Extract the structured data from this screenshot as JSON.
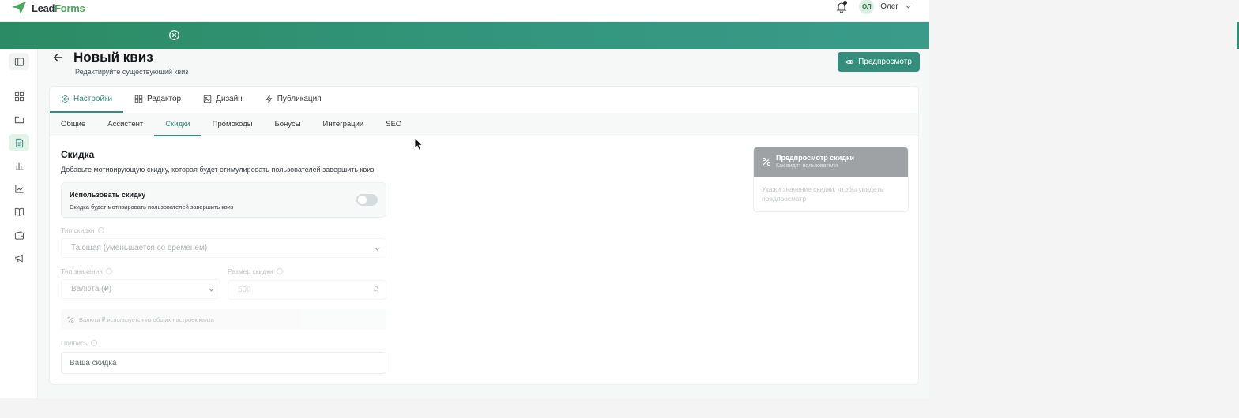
{
  "header": {
    "logo_lead": "Lead",
    "logo_forms": "Forms",
    "user_initials": "ОЛ",
    "user_name": "Олег"
  },
  "page": {
    "title": "Новый квиз",
    "subtitle": "Редактируйте существующий квиз",
    "preview_button": "Предпросмотр"
  },
  "tabs": [
    {
      "label": "Настройки",
      "icon": "gear-icon",
      "active": true
    },
    {
      "label": "Редактор",
      "icon": "grid-icon",
      "active": false
    },
    {
      "label": "Дизайн",
      "icon": "image-icon",
      "active": false
    },
    {
      "label": "Публикация",
      "icon": "bolt-icon",
      "active": false
    }
  ],
  "subtabs": [
    {
      "label": "Общие",
      "active": false
    },
    {
      "label": "Ассистент",
      "active": false
    },
    {
      "label": "Скидки",
      "active": true
    },
    {
      "label": "Промокоды",
      "active": false
    },
    {
      "label": "Бонусы",
      "active": false
    },
    {
      "label": "Интеграции",
      "active": false
    },
    {
      "label": "SEO",
      "active": false
    }
  ],
  "discount": {
    "title": "Скидка",
    "description": "Добавьте мотивирующую скидку, которая будет стимулировать пользователей завершить квиз",
    "use_title": "Использовать скидку",
    "use_description": "Скидка будет мотивировать пользователей завершить квиз",
    "enabled": false,
    "type_label": "Тип скидки",
    "type_value": "Тающая (уменьшается со временем)",
    "value_type_label": "Тип значения",
    "value_type_value": "Валюта (₽)",
    "size_label": "Размер скидки",
    "size_placeholder": "500",
    "currency_symbol": "₽",
    "note": "Валюта ₽ используется из общих настроек квиза",
    "caption_label": "Подпись",
    "caption_value": "Ваша скидка"
  },
  "preview": {
    "title": "Предпросмотр скидки",
    "subtitle": "Как видят пользователи",
    "body": "Укажи значение скидки, чтобы увидеть предпросмотр"
  },
  "colors": {
    "accent": "#358e7c",
    "banner": "#2f8d72",
    "logo_green": "#48a85b"
  }
}
